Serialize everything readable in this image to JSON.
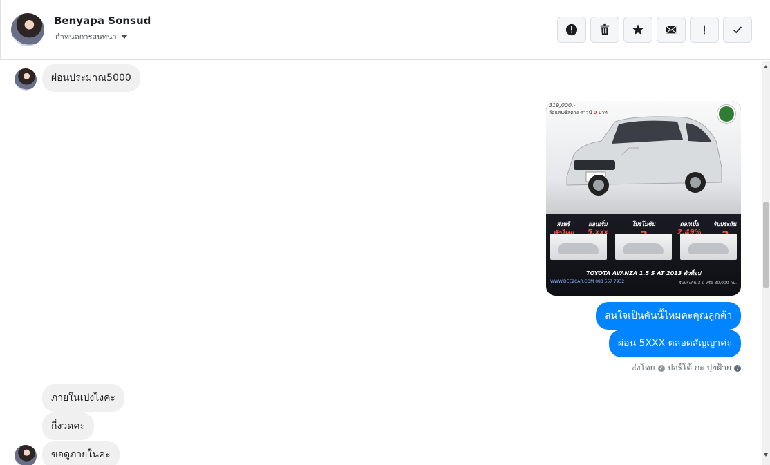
{
  "header": {
    "name": "Benyapa Sonsud",
    "subtitle": "กำหนดการสนทนา"
  },
  "actions": [
    {
      "name": "report-button",
      "icon": "alert-circle-icon"
    },
    {
      "name": "delete-button",
      "icon": "trash-icon"
    },
    {
      "name": "star-button",
      "icon": "star-icon"
    },
    {
      "name": "mail-button",
      "icon": "envelope-icon"
    },
    {
      "name": "mark-important-button",
      "icon": "exclamation-icon"
    },
    {
      "name": "done-button",
      "icon": "check-icon"
    }
  ],
  "messages": {
    "m1": "ผ่อนประมาณ5000",
    "m2": "สนใจเป็นคันนี้ไหมคะคุณลูกค้า",
    "m3": "ผ่อน 5XXX ตลอดสัญญาค่ะ",
    "sent_by_prefix": "ส่งโดย",
    "sent_by_name": "ปอร์โต้ กะ ปุยฝ้าย",
    "m4": "ภายในเปงไงคะ",
    "m5": "กี่งวดคะ",
    "m6": "ขอดูภายในคะ"
  },
  "car_card": {
    "price": "319,000.-",
    "promo": "ล้อแสนซ์สตาง ดาวน์",
    "promo_value": "0",
    "promo_unit": "บาท",
    "features": [
      {
        "label": "ส่งฟรี",
        "value": "ทั่วไทย"
      },
      {
        "label": "ผ่อนเริ่ม",
        "value": "5,xxx"
      },
      {
        "label": "โปรโมชั่น",
        "value": "3"
      },
      {
        "label": "ดอกเบี้ย",
        "value": "2.49%"
      },
      {
        "label": "รับประกัน",
        "value": "3"
      }
    ],
    "model": "TOYOTA AVANZA 1.5 S AT 2013 ตัวท็อป",
    "website": "WWW.DEE2CAR.COM  088 557 7932",
    "warranty": "รับประกัน 3 ปี หรือ 30,000 กม."
  },
  "colors": {
    "outgoing": "#0084ff",
    "incoming": "#f1f0f0"
  }
}
